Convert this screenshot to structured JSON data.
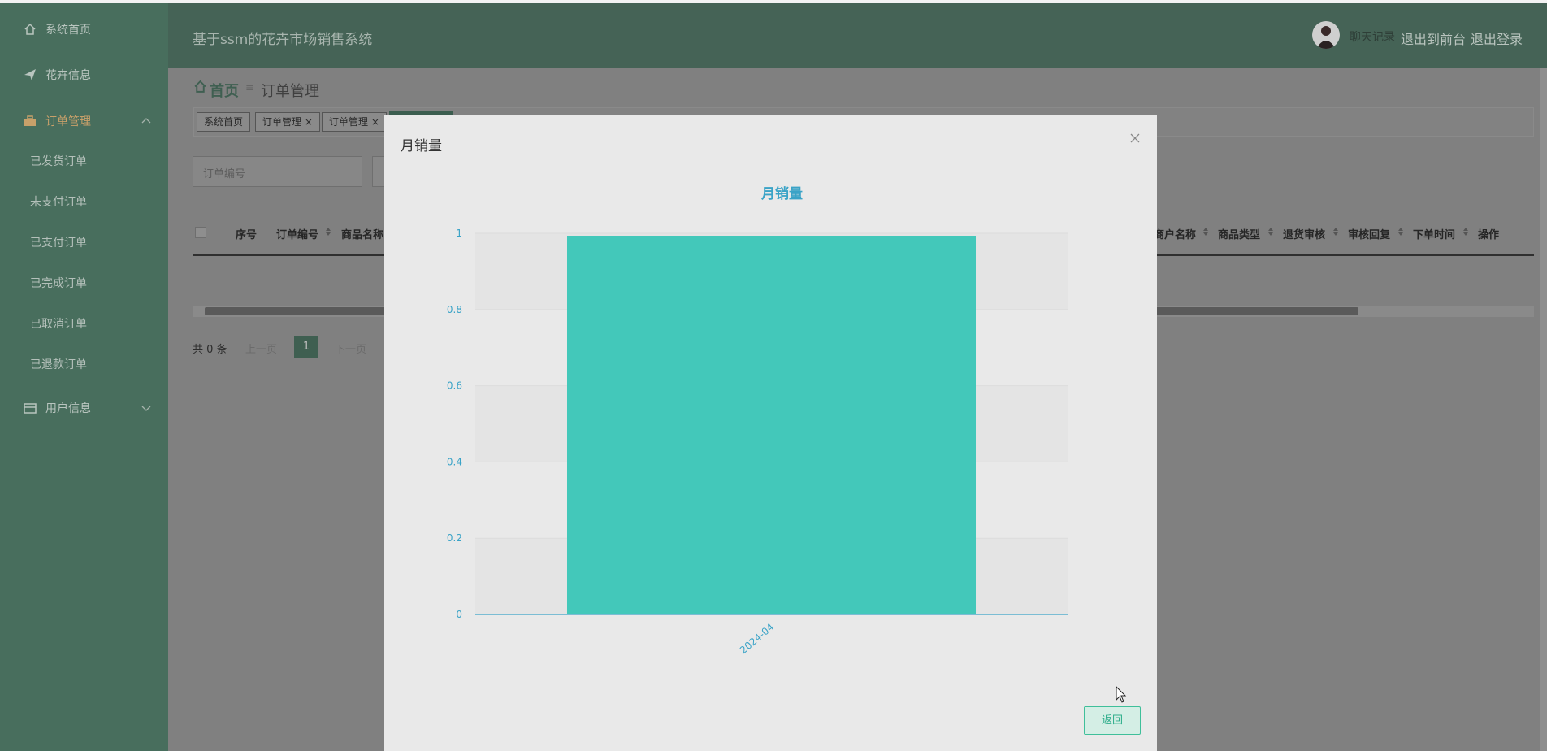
{
  "sidebar": {
    "items": [
      {
        "label": "系统首页",
        "icon": "home-icon"
      },
      {
        "label": "花卉信息",
        "icon": "send-icon"
      },
      {
        "label": "订单管理",
        "icon": "briefcase-icon"
      },
      {
        "label": "用户信息",
        "icon": "card-icon"
      }
    ],
    "sub_items": [
      "已发货订单",
      "未支付订单",
      "已支付订单",
      "已完成订单",
      "已取消订单",
      "已退款订单"
    ]
  },
  "header": {
    "title": "基于ssm的花卉市场销售系统",
    "user": "聊天记录",
    "links": [
      "退出到前台",
      "退出登录"
    ]
  },
  "breadcrumb": {
    "home": "首页",
    "separator": "≡",
    "current": "订单管理"
  },
  "tabs": [
    "系统首页",
    "订单管理",
    "订单管理"
  ],
  "search": {
    "placeholder": "订单编号"
  },
  "table": {
    "columns_left": [
      "序号",
      "订单编号",
      "商品名称"
    ],
    "columns_right": [
      "商户名称",
      "商品类型",
      "退货审核",
      "审核回复",
      "下单时间",
      "操作"
    ]
  },
  "pagination": {
    "total": "共 0 条",
    "prev": "上一页",
    "page": "1",
    "next": "下一页"
  },
  "modal": {
    "title": "月销量",
    "back_label": "返回"
  },
  "chart_data": {
    "type": "bar",
    "title": "月销量",
    "categories": [
      "2024-04"
    ],
    "values": [
      1
    ],
    "ylim": [
      0,
      1
    ],
    "yticks": [
      "0",
      "0.2",
      "0.4",
      "0.6",
      "0.8",
      "1"
    ],
    "xlabel": "",
    "ylabel": "",
    "bar_color": "#43c8ba",
    "axis_color": "#3aa3c7",
    "grid": true
  },
  "colors": {
    "sidebar": "#486e5d",
    "header": "#456356",
    "accent": "#3fbf9a"
  }
}
